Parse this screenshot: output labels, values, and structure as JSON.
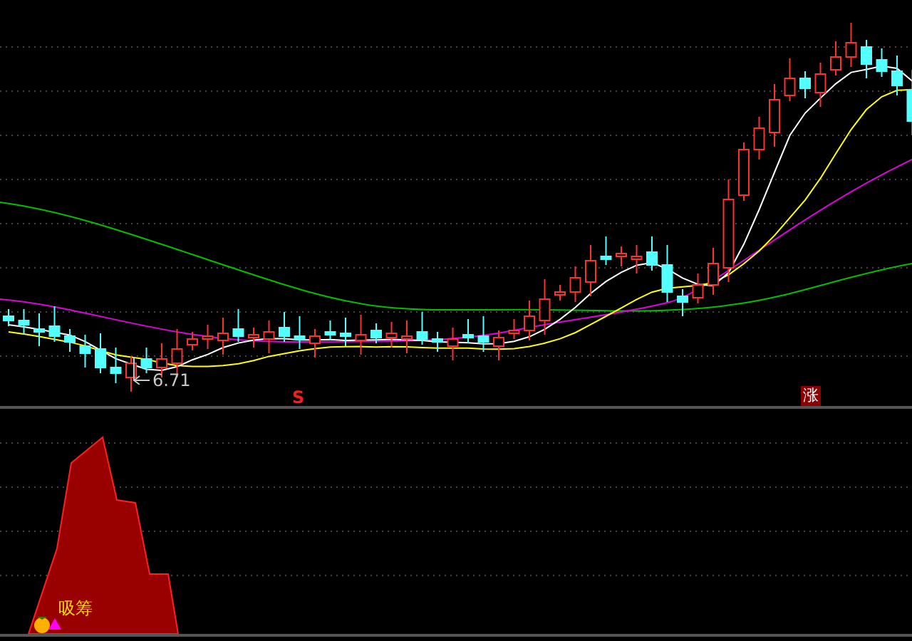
{
  "main_chart": {
    "price_label": "6.71",
    "signal_marks": [
      {
        "text": "S",
        "kind": "sell"
      },
      {
        "text": "涨",
        "kind": "rise"
      }
    ]
  },
  "indicator_panel": {
    "label": "吸筹"
  }
}
